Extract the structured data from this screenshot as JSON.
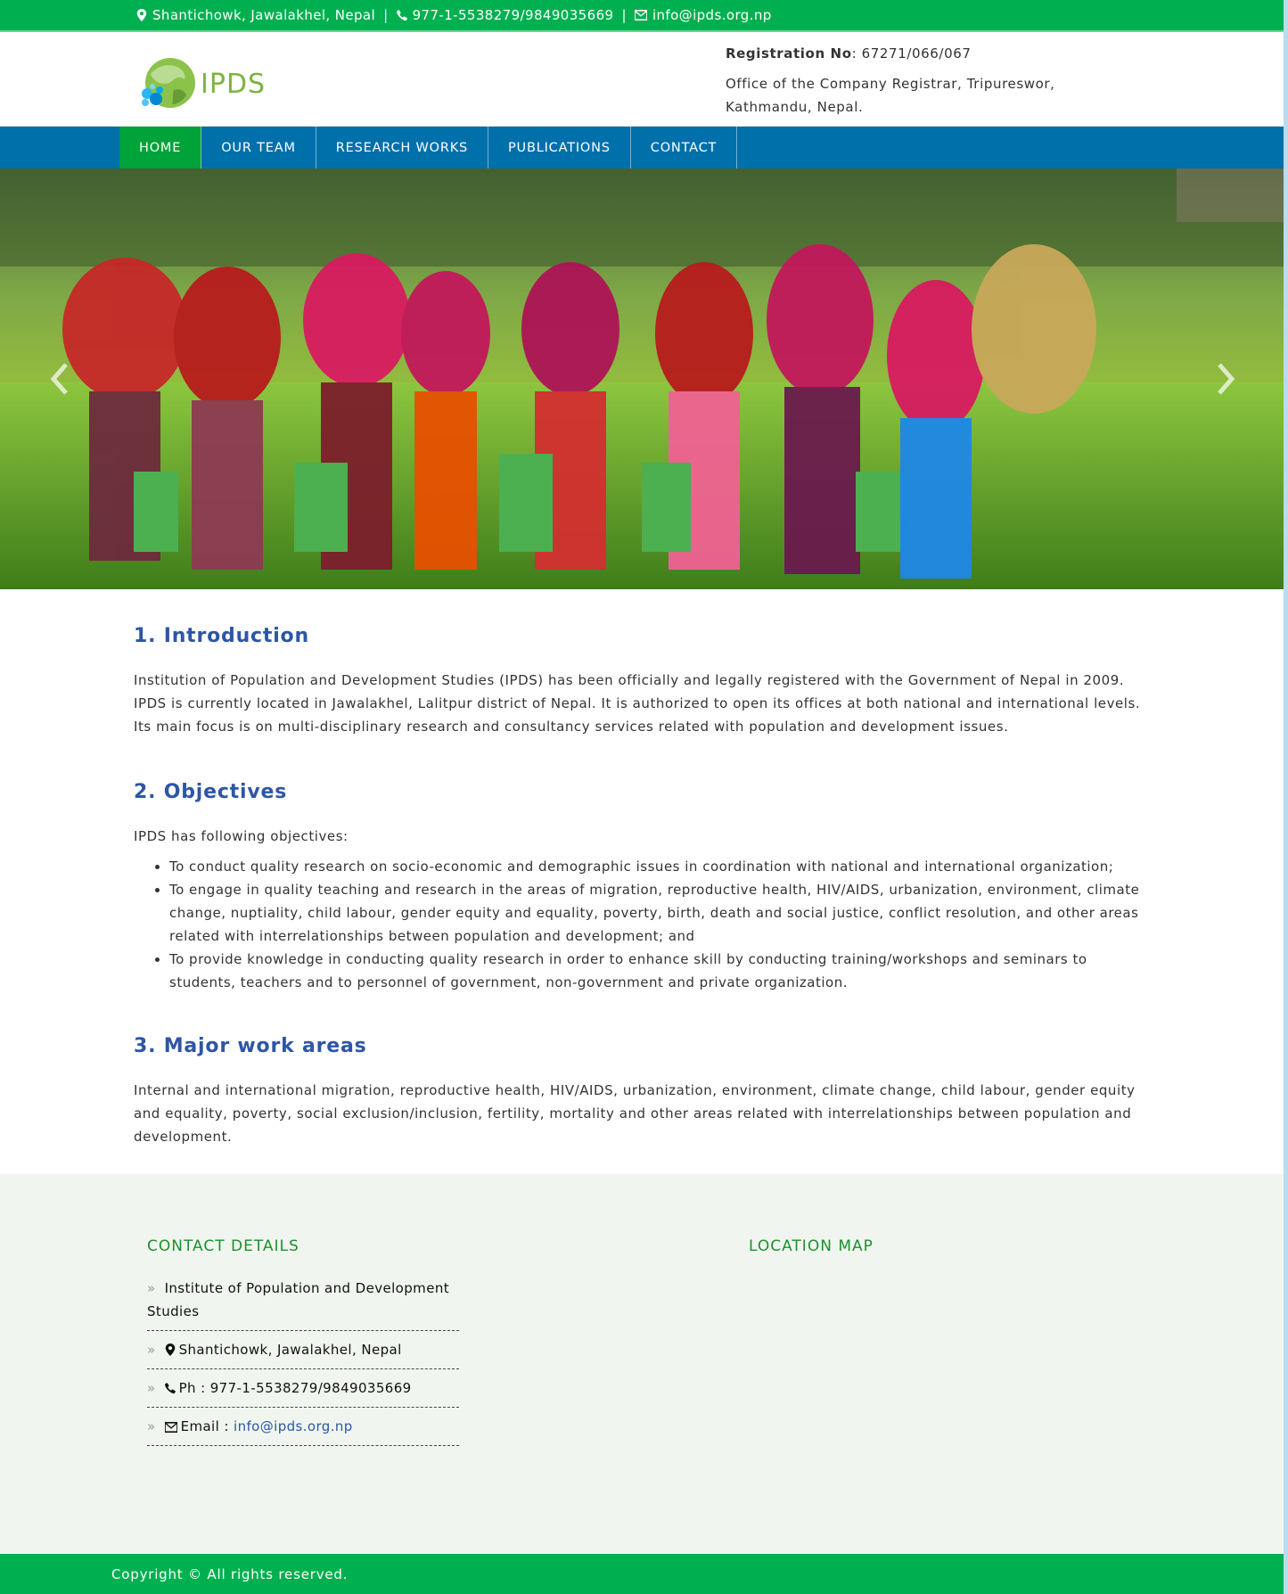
{
  "topbar": {
    "address": "Shantichowk, Jawalakhel, Nepal",
    "phone": "977-1-5538279/9849035669",
    "email": "info@ipds.org.np",
    "separator": "|"
  },
  "header": {
    "logo_text": "IPDS",
    "registration_label": "Registration No",
    "registration_value": ": 67271/066/067",
    "office": "Office of the Company Registrar, Tripureswor, Kathmandu, Nepal."
  },
  "nav": {
    "items": [
      {
        "label": "HOME"
      },
      {
        "label": "OUR TEAM"
      },
      {
        "label": "RESEARCH WORKS"
      },
      {
        "label": "PUBLICATIONS"
      },
      {
        "label": "CONTACT"
      }
    ]
  },
  "main": {
    "intro": {
      "title": "1. Introduction",
      "text": "Institution of Population and Development Studies (IPDS) has been officially and legally registered with the Government of Nepal in 2009. IPDS is currently located in Jawalakhel, Lalitpur district of Nepal. It is authorized to open its offices at both national and international levels. Its main focus is on multi-disciplinary research and consultancy services related with population and development issues."
    },
    "objectives": {
      "title": "2. Objectives",
      "lead": "IPDS has following objectives:",
      "items": [
        "To conduct quality research on socio-economic and demographic issues in coordination with national and international organization;",
        "To engage in quality teaching and research in the areas of migration, reproductive health, HIV/AIDS, urbanization, environment, climate change, nuptiality, child labour, gender equity and equality, poverty, birth, death and social justice, conflict resolution, and other areas related with interrelationships between population and development; and",
        "To provide knowledge in conducting quality research in order to enhance skill by conducting training/workshops and seminars to students, teachers and to personnel of government, non-government and private organization."
      ]
    },
    "work_areas": {
      "title": "3. Major work areas",
      "text": "Internal and international migration, reproductive health, HIV/AIDS, urbanization, environment, climate change, child labour, gender equity and equality, poverty, social exclusion/inclusion, fertility, mortality and other areas related with interrelationships between population and development."
    }
  },
  "footer": {
    "contact_heading": "CONTACT DETAILS",
    "map_heading": "LOCATION MAP",
    "bullet": "»",
    "org_name": "Institute of Population and Development Studies",
    "address": "Shantichowk, Jawalakhel, Nepal",
    "phone": "Ph : 977-1-5538279/9849035669",
    "email_label": "Email :",
    "email": "info@ipds.org.np",
    "copyright": "Copyright © All rights reserved."
  },
  "colors": {
    "topbar": "#00b050",
    "nav": "#0070ab",
    "nav_active": "#00a23a",
    "heading": "#2e56a6",
    "footer_heading": "#1e8f2e"
  },
  "icons": [
    "map-marker-icon",
    "phone-icon",
    "envelope-icon",
    "chevron-left-icon",
    "chevron-right-icon"
  ]
}
